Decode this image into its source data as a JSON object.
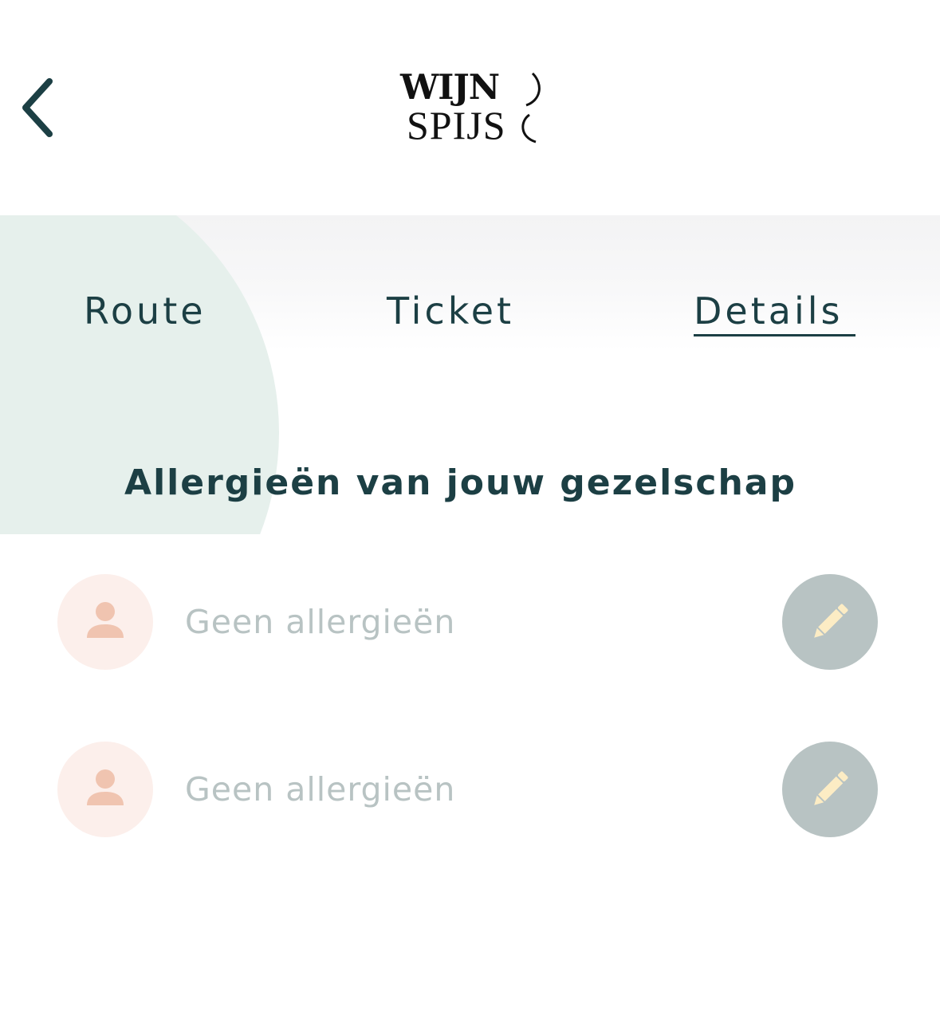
{
  "header": {
    "back_icon": "chevron-left-icon",
    "logo": {
      "line1": "WIJN",
      "line2": "SPIJS"
    }
  },
  "tabs": [
    {
      "label": "Route",
      "active": false
    },
    {
      "label": "Ticket",
      "active": false
    },
    {
      "label": "Details",
      "active": true
    }
  ],
  "section": {
    "title": "Allergieën van jouw gezelschap"
  },
  "guests": [
    {
      "text": "Geen allergieën",
      "avatar_icon": "person-icon",
      "edit_icon": "pencil-icon"
    },
    {
      "text": "Geen allergieën",
      "avatar_icon": "person-icon",
      "edit_icon": "pencil-icon"
    }
  ],
  "colors": {
    "primary": "#1c3f44",
    "blob": "#e6f0ec",
    "avatar_bg": "#fcefeb",
    "avatar_icon": "#f0c4b0",
    "edit_bg": "#b8c3c3",
    "edit_icon": "#fcecc4",
    "muted_text": "#b8c3c3"
  }
}
